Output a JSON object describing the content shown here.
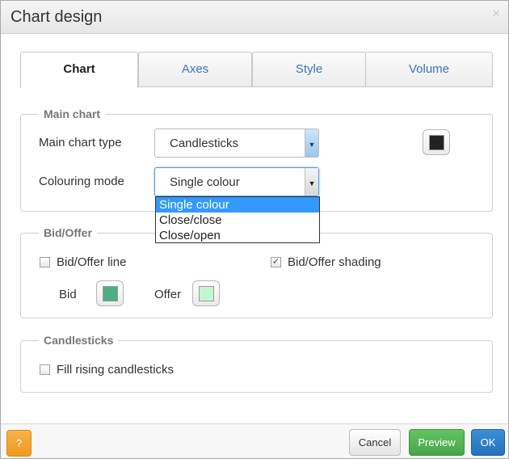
{
  "dialog": {
    "title": "Chart design",
    "close_glyph": "×"
  },
  "tabs": [
    {
      "label": "Chart",
      "active": true
    },
    {
      "label": "Axes"
    },
    {
      "label": "Style"
    },
    {
      "label": "Volume"
    }
  ],
  "main_chart": {
    "legend": "Main chart",
    "type_label": "Main chart type",
    "type_value": "Candlesticks",
    "colour_label": "Colouring mode",
    "colour_value": "Single colour",
    "swatch_color": "#222222",
    "dropdown_options": [
      "Single colour",
      "Close/close",
      "Close/open"
    ],
    "dropdown_selected": "Single colour"
  },
  "bid_offer": {
    "legend": "Bid/Offer",
    "line_label": "Bid/Offer line",
    "line_checked": false,
    "shading_label": "Bid/Offer shading",
    "shading_checked": true,
    "bid_label": "Bid",
    "bid_color": "#4caf82",
    "offer_label": "Offer",
    "offer_color": "#c2f5d2"
  },
  "candlesticks": {
    "legend": "Candlesticks",
    "fill_rising_label": "Fill rising candlesticks",
    "fill_rising_checked": false
  },
  "footer": {
    "help_label": "?",
    "cancel_label": "Cancel",
    "preview_label": "Preview",
    "ok_label": "OK"
  },
  "icons": {
    "dropdown_arrow": "▼",
    "check": "✓"
  }
}
